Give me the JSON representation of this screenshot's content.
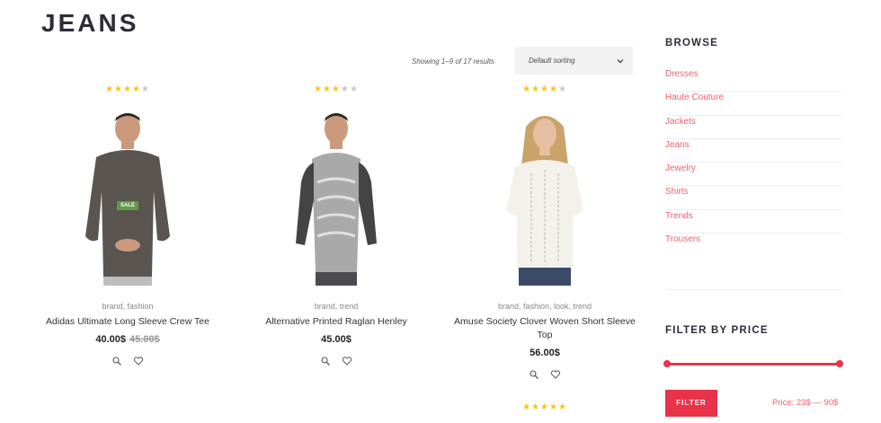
{
  "page": {
    "title": "JEANS"
  },
  "toolbar": {
    "result_count": "Showing 1–9 of 17 results",
    "sort_selected": "Default sorting"
  },
  "products": [
    {
      "rating": 4,
      "categories": "brand, fashion",
      "name": "Adidas Ultimate Long Sleeve Crew Tee",
      "price": "40.00$",
      "old_price": "45.00$",
      "badge": "SALE"
    },
    {
      "rating": 3,
      "categories": "brand, trend",
      "name": "Alternative Printed Raglan Henley",
      "price": "45.00$"
    },
    {
      "rating": 4,
      "categories": "brand, fashion, look, trend",
      "name": "Amuse Society Clover Woven Short Sleeve Top",
      "price": "56.00$"
    }
  ],
  "next_row_rating": 5,
  "sidebar": {
    "browse_title": "BROWSE",
    "categories": [
      "Dresses",
      "Haute Couture",
      "Jackets",
      "Jeans",
      "Jewelry",
      "Shirts",
      "Trends",
      "Trousers"
    ],
    "filter_title": "FILTER BY PRICE",
    "filter_button": "FILTER",
    "price_label": "Price: 23$ — 90$",
    "price_min": 23,
    "price_max": 90
  },
  "colors": {
    "accent": "#e8334a",
    "link": "#f06070",
    "star": "#f5c518",
    "sale": "#5e9b46",
    "title": "#2d2d3a"
  },
  "icons": {
    "sort": "chevron-down-icon",
    "quick_view": "zoom-icon",
    "wishlist": "heart-icon"
  }
}
